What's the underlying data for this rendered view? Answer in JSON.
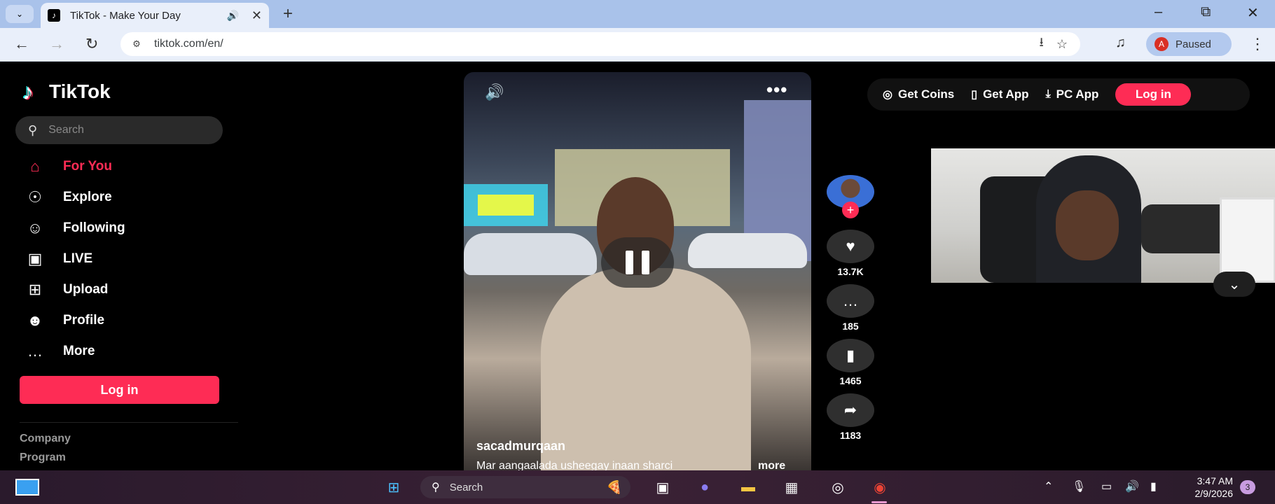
{
  "browser": {
    "tab": {
      "title": "TikTok - Make Your Day"
    },
    "url": "tiktok.com/en/",
    "profile_status": "Paused",
    "profile_initial": "A"
  },
  "sidebar": {
    "logo_text": "TikTok",
    "search_placeholder": "Search",
    "nav": [
      {
        "label": "For You",
        "icon": "home-icon"
      },
      {
        "label": "Explore",
        "icon": "compass-icon"
      },
      {
        "label": "Following",
        "icon": "following-icon"
      },
      {
        "label": "LIVE",
        "icon": "live-icon"
      },
      {
        "label": "Upload",
        "icon": "upload-icon"
      },
      {
        "label": "Profile",
        "icon": "profile-icon"
      },
      {
        "label": "More",
        "icon": "more-icon"
      }
    ],
    "login_label": "Log in",
    "footer": [
      "Company",
      "Program"
    ]
  },
  "header": {
    "get_coins": "Get Coins",
    "get_app": "Get App",
    "pc_app": "PC App",
    "login": "Log in"
  },
  "video": {
    "author": "sacadmurqaan",
    "caption": "Mar aangaalada usheegay inaan sharci",
    "caption_more": "more",
    "likes": "13.7K",
    "comments": "185",
    "saves": "1465",
    "shares": "1183"
  },
  "taskbar": {
    "search_placeholder": "Search",
    "time": "3:47 AM",
    "date": "2/9/2026",
    "notification_count": "3"
  },
  "colors": {
    "brand": "#fe2c55",
    "chrome_bg": "#a9c2ea"
  }
}
